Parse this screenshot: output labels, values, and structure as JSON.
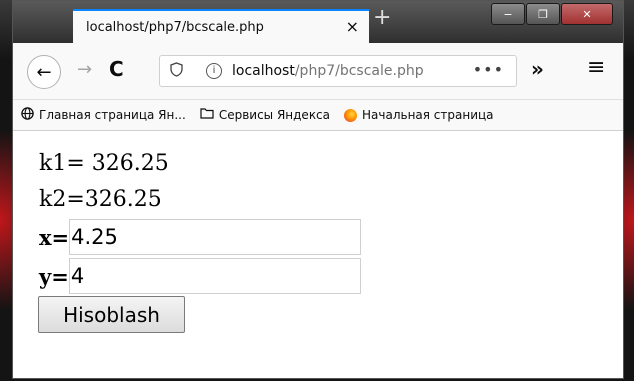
{
  "tab": {
    "title": "localhost/php7/bcscale.php",
    "close": "×",
    "new_tab": "+"
  },
  "window_controls": {
    "minimize": "−",
    "maximize": "❐",
    "close": "✕"
  },
  "nav": {
    "back": "←",
    "forward": "→",
    "reload": "C",
    "url_host": "localhost",
    "url_path": "/php7/bcscale.php",
    "page_actions": "•••",
    "overflow": "»",
    "menu": "≡"
  },
  "bookmarks": [
    {
      "icon": "globe-icon",
      "label": "Главная страница Ян..."
    },
    {
      "icon": "folder-icon",
      "label": "Сервисы Яндекса"
    },
    {
      "icon": "firefox-icon",
      "label": "Начальная страница"
    }
  ],
  "page": {
    "k1": "k1= 326.25",
    "k2": "k2=326.25",
    "x_label": "x=",
    "x_value": "4.25",
    "y_label": "y=",
    "y_value": "4",
    "submit_label": "Hisoblash"
  }
}
